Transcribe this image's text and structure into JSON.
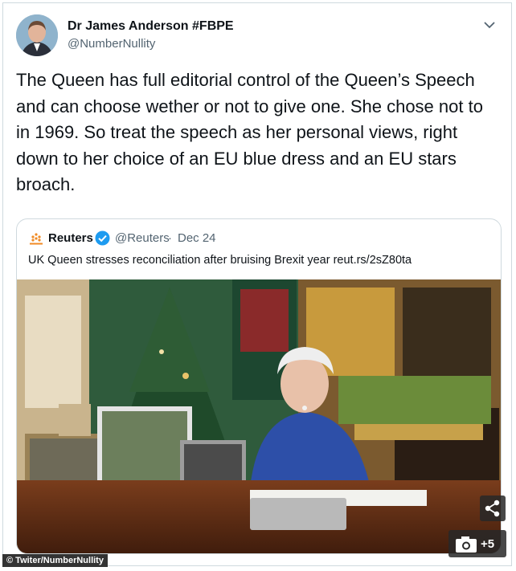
{
  "tweet": {
    "author_name": "Dr James Anderson #FBPE",
    "author_handle": "@NumberNullity",
    "text": "The Queen has full editorial control of the Queen’s Speech and can choose wether or not to give one. She chose not to in 1969. So treat the speech as her personal views, right down to her choice of an EU blue dress and an EU stars broach."
  },
  "quoted_tweet": {
    "author_name": "Reuters",
    "author_handle": "@Reuters",
    "separator": "·",
    "date": "Dec 24",
    "headline": "UK Queen stresses reconciliation after bruising Brexit year reut.rs/2sZ80ta"
  },
  "overlay": {
    "gallery_count": "+5",
    "credit": "© Twiter/NumberNullity"
  },
  "icons": [
    "avatar",
    "chevron-down-icon",
    "reuters-logo-icon",
    "verified-badge-icon",
    "share-icon",
    "camera-icon"
  ],
  "colors": {
    "text": "#0f1419",
    "secondary": "#536471",
    "border": "#cfd9de",
    "verified": "#1d9bf0",
    "overlay": "#282828"
  }
}
